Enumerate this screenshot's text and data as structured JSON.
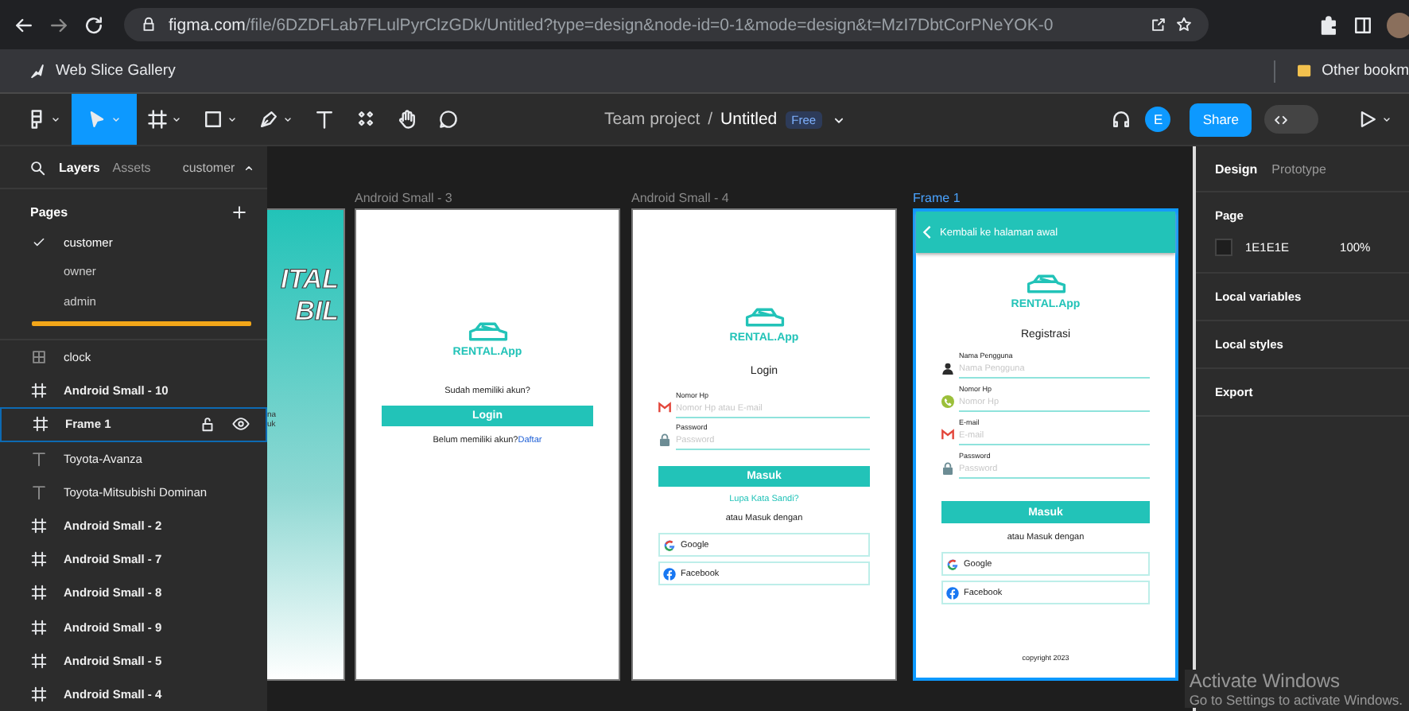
{
  "browser": {
    "url_host": "figma.com",
    "url_path": "/file/6DZDFLab7FLulPyrClzGDk/Untitled?type=design&node-id=0-1&mode=design&t=MzI7DbtCorPNeYOK-0",
    "bookmarks": [
      "Web Slice Gallery"
    ],
    "other_bookmarks": "Other bookm"
  },
  "toolbar": {
    "tools": [
      {
        "kind": "move",
        "selected": true
      },
      {
        "kind": "frame",
        "selected": false
      },
      {
        "kind": "rect",
        "selected": false
      },
      {
        "kind": "pen",
        "selected": false
      },
      {
        "kind": "text",
        "selected": false
      },
      {
        "kind": "components",
        "selected": false
      },
      {
        "kind": "hand",
        "selected": false
      },
      {
        "kind": "comment",
        "selected": false
      }
    ],
    "dev_mode": false,
    "project": "Team project",
    "separator": "/",
    "file": "Untitled",
    "badge": "Free",
    "avatar": "E",
    "share": "Share"
  },
  "left_panel": {
    "tabs": [
      {
        "label": "Layers",
        "selected": true
      },
      {
        "label": "Assets",
        "selected": false
      }
    ],
    "page_menu": "customer",
    "pages_title": "Pages",
    "pages": [
      {
        "label": "customer",
        "selected": true
      },
      {
        "label": "owner",
        "selected": false
      },
      {
        "label": "admin",
        "selected": false
      }
    ],
    "layers": [
      {
        "label": "clock",
        "kind": "component",
        "selected": false
      },
      {
        "label": "Android Small - 10",
        "kind": "frame",
        "selected": false
      },
      {
        "label": "Frame 1",
        "kind": "frame",
        "selected": true
      },
      {
        "label": "Toyota-Avanza",
        "kind": "text",
        "selected": false
      },
      {
        "label": "Toyota-Mitsubishi Dominan",
        "kind": "text",
        "selected": false
      },
      {
        "label": "Android Small - 2",
        "kind": "frame",
        "selected": false
      },
      {
        "label": "Android Small - 7",
        "kind": "frame",
        "selected": false
      },
      {
        "label": "Android Small - 8",
        "kind": "frame",
        "selected": false
      },
      {
        "label": "Android Small - 9",
        "kind": "frame",
        "selected": false
      },
      {
        "label": "Android Small - 5",
        "kind": "frame",
        "selected": false
      },
      {
        "label": "Android Small - 4",
        "kind": "frame",
        "selected": false
      }
    ]
  },
  "canvas": {
    "frames": [
      {
        "kind": "splash",
        "selected": false,
        "headline": [
          "ITAL",
          "BIL"
        ],
        "snippets": [
          "na",
          "uk"
        ]
      },
      {
        "kind": "welcome",
        "label": "Android Small - 3",
        "selected": false,
        "logo": "RENTAL.App",
        "question": "Sudah memiliki akun?",
        "button": "Login",
        "footer": "Belum memiliki akun?",
        "link": "Daftar"
      },
      {
        "kind": "login",
        "label": "Android Small - 4",
        "selected": false,
        "logo": "RENTAL.App",
        "title": "Login",
        "fields": [
          {
            "label": "Nomor Hp",
            "placeholder": "Nomor Hp atau E-mail",
            "kind": "mail"
          },
          {
            "label": "Password",
            "placeholder": "Password",
            "kind": "lock"
          }
        ],
        "button": "Masuk",
        "forgot": "Lupa Kata Sandi?",
        "alt": "atau Masuk dengan",
        "socials": [
          {
            "kind": "google",
            "label": "Google"
          },
          {
            "kind": "facebook",
            "label": "Facebook"
          }
        ]
      },
      {
        "kind": "register",
        "label": "Frame 1",
        "selected": true,
        "header": "Kembali ke halaman awal",
        "logo": "RENTAL.App",
        "title": "Registrasi",
        "fields": [
          {
            "label": "Nama Pengguna",
            "placeholder": "Nama Pengguna",
            "kind": "person"
          },
          {
            "label": "Nomor Hp",
            "placeholder": "Nomor Hp",
            "kind": "phone"
          },
          {
            "label": "E-mail",
            "placeholder": "E-mail",
            "kind": "mail"
          },
          {
            "label": "Password",
            "placeholder": "Password",
            "kind": "lock"
          }
        ],
        "button": "Masuk",
        "alt": "atau Masuk dengan",
        "socials": [
          {
            "kind": "google",
            "label": "Google"
          },
          {
            "kind": "facebook",
            "label": "Facebook"
          }
        ],
        "copyright": "copyright 2023"
      }
    ]
  },
  "right_panel": {
    "tabs": [
      {
        "label": "Design",
        "selected": true
      },
      {
        "label": "Prototype",
        "selected": false
      }
    ],
    "page_title": "Page",
    "color": "#1e1e1e",
    "color_hex": "1E1E1E",
    "opacity": "100%",
    "sections": [
      "Local variables",
      "Local styles",
      "Export"
    ]
  },
  "os_notice": {
    "title": "Activate Windows",
    "text": "Go to Settings to activate Windows."
  }
}
